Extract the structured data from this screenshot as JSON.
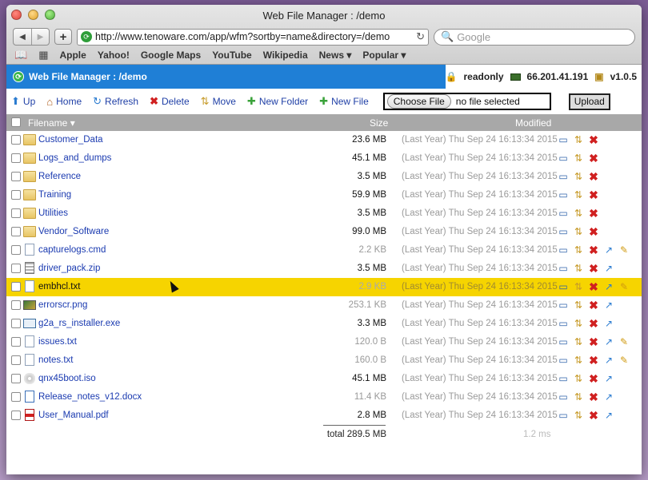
{
  "browser": {
    "window_title": "Web File Manager : /demo",
    "url": "http://www.tenoware.com/app/wfm?sortby=name&directory=/demo",
    "search_placeholder": "Google",
    "bookmarks": [
      "Apple",
      "Yahoo!",
      "Google Maps",
      "YouTube",
      "Wikipedia",
      "News ▾",
      "Popular ▾"
    ]
  },
  "app": {
    "title": "Web File Manager : /demo",
    "mode": "readonly",
    "ip": "66.201.41.191",
    "version": "v1.0.5"
  },
  "toolbar": {
    "up": "Up",
    "home": "Home",
    "refresh": "Refresh",
    "delete": "Delete",
    "move": "Move",
    "new_folder": "New Folder",
    "new_file": "New File",
    "choose_file": "Choose File",
    "file_status": "no file selected",
    "upload": "Upload"
  },
  "columns": {
    "filename": "Filename ▾",
    "size": "Size",
    "modified": "Modified"
  },
  "files": [
    {
      "name": "Customer_Data",
      "type": "folder",
      "size": "23.6 MB",
      "modified": "(Last Year) Thu Sep 24 16:13:34 2015"
    },
    {
      "name": "Logs_and_dumps",
      "type": "folder",
      "size": "45.1 MB",
      "modified": "(Last Year) Thu Sep 24 16:13:34 2015"
    },
    {
      "name": "Reference",
      "type": "folder",
      "size": "3.5 MB",
      "modified": "(Last Year) Thu Sep 24 16:13:34 2015"
    },
    {
      "name": "Training",
      "type": "folder",
      "size": "59.9 MB",
      "modified": "(Last Year) Thu Sep 24 16:13:34 2015"
    },
    {
      "name": "Utilities",
      "type": "folder",
      "size": "3.5 MB",
      "modified": "(Last Year) Thu Sep 24 16:13:34 2015"
    },
    {
      "name": "Vendor_Software",
      "type": "folder",
      "size": "99.0 MB",
      "modified": "(Last Year) Thu Sep 24 16:13:34 2015"
    },
    {
      "name": "capturelogs.cmd",
      "type": "doc",
      "size": "2.2 KB",
      "modified": "(Last Year) Thu Sep 24 16:13:34 2015"
    },
    {
      "name": "driver_pack.zip",
      "type": "zip",
      "size": "3.5 MB",
      "modified": "(Last Year) Thu Sep 24 16:13:34 2015"
    },
    {
      "name": "embhcl.txt",
      "type": "doc",
      "size": "2.9 KB",
      "modified": "(Last Year) Thu Sep 24 16:13:34 2015"
    },
    {
      "name": "errorscr.png",
      "type": "img",
      "size": "253.1 KB",
      "modified": "(Last Year) Thu Sep 24 16:13:34 2015"
    },
    {
      "name": "g2a_rs_installer.exe",
      "type": "exe",
      "size": "3.3 MB",
      "modified": "(Last Year) Thu Sep 24 16:13:34 2015"
    },
    {
      "name": "issues.txt",
      "type": "doc",
      "size": "120.0 B",
      "modified": "(Last Year) Thu Sep 24 16:13:34 2015"
    },
    {
      "name": "notes.txt",
      "type": "doc",
      "size": "160.0 B",
      "modified": "(Last Year) Thu Sep 24 16:13:34 2015"
    },
    {
      "name": "qnx45boot.iso",
      "type": "iso",
      "size": "45.1 MB",
      "modified": "(Last Year) Thu Sep 24 16:13:34 2015"
    },
    {
      "name": "Release_notes_v12.docx",
      "type": "docx",
      "size": "11.4 KB",
      "modified": "(Last Year) Thu Sep 24 16:13:34 2015"
    },
    {
      "name": "User_Manual.pdf",
      "type": "pdf",
      "size": "2.8 MB",
      "modified": "(Last Year) Thu Sep 24 16:13:34 2015"
    }
  ],
  "footer": {
    "total": "total 289.5 MB",
    "elapsed": "1.2 ms"
  }
}
